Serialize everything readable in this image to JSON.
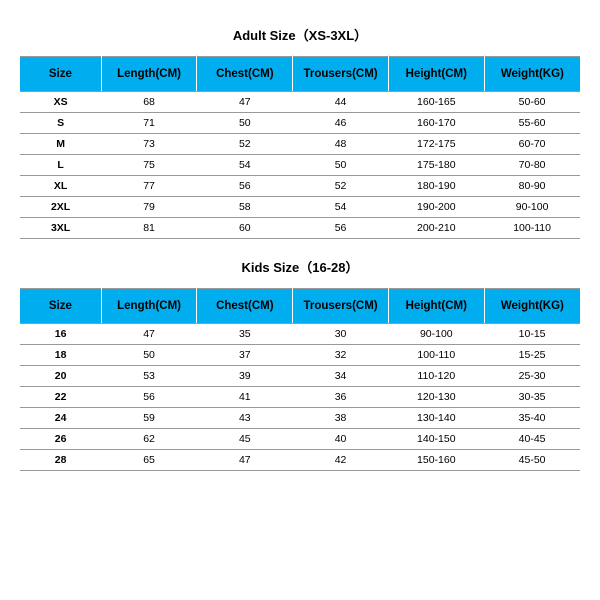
{
  "adult": {
    "title": "Adult Size（XS-3XL）",
    "headers": [
      "Size",
      "Length(CM)",
      "Chest(CM)",
      "Trousers(CM)",
      "Height(CM)",
      "Weight(KG)"
    ],
    "rows": [
      {
        "size": "XS",
        "length": "68",
        "chest": "47",
        "trousers": "44",
        "height": "160-165",
        "weight": "50-60"
      },
      {
        "size": "S",
        "length": "71",
        "chest": "50",
        "trousers": "46",
        "height": "160-170",
        "weight": "55-60"
      },
      {
        "size": "M",
        "length": "73",
        "chest": "52",
        "trousers": "48",
        "height": "172-175",
        "weight": "60-70"
      },
      {
        "size": "L",
        "length": "75",
        "chest": "54",
        "trousers": "50",
        "height": "175-180",
        "weight": "70-80"
      },
      {
        "size": "XL",
        "length": "77",
        "chest": "56",
        "trousers": "52",
        "height": "180-190",
        "weight": "80-90"
      },
      {
        "size": "2XL",
        "length": "79",
        "chest": "58",
        "trousers": "54",
        "height": "190-200",
        "weight": "90-100"
      },
      {
        "size": "3XL",
        "length": "81",
        "chest": "60",
        "trousers": "56",
        "height": "200-210",
        "weight": "100-110"
      }
    ]
  },
  "kids": {
    "title": "Kids Size（16-28）",
    "headers": [
      "Size",
      "Length(CM)",
      "Chest(CM)",
      "Trousers(CM)",
      "Height(CM)",
      "Weight(KG)"
    ],
    "rows": [
      {
        "size": "16",
        "length": "47",
        "chest": "35",
        "trousers": "30",
        "height": "90-100",
        "weight": "10-15"
      },
      {
        "size": "18",
        "length": "50",
        "chest": "37",
        "trousers": "32",
        "height": "100-110",
        "weight": "15-25"
      },
      {
        "size": "20",
        "length": "53",
        "chest": "39",
        "trousers": "34",
        "height": "110-120",
        "weight": "25-30"
      },
      {
        "size": "22",
        "length": "56",
        "chest": "41",
        "trousers": "36",
        "height": "120-130",
        "weight": "30-35"
      },
      {
        "size": "24",
        "length": "59",
        "chest": "43",
        "trousers": "38",
        "height": "130-140",
        "weight": "35-40"
      },
      {
        "size": "26",
        "length": "62",
        "chest": "45",
        "trousers": "40",
        "height": "140-150",
        "weight": "40-45"
      },
      {
        "size": "28",
        "length": "65",
        "chest": "47",
        "trousers": "42",
        "height": "150-160",
        "weight": "45-50"
      }
    ]
  },
  "chart_data": [
    {
      "type": "table",
      "title": "Adult Size (XS-3XL)",
      "columns": [
        "Size",
        "Length(CM)",
        "Chest(CM)",
        "Trousers(CM)",
        "Height(CM)",
        "Weight(KG)"
      ],
      "rows": [
        [
          "XS",
          68,
          47,
          44,
          "160-165",
          "50-60"
        ],
        [
          "S",
          71,
          50,
          46,
          "160-170",
          "55-60"
        ],
        [
          "M",
          73,
          52,
          48,
          "172-175",
          "60-70"
        ],
        [
          "L",
          75,
          54,
          50,
          "175-180",
          "70-80"
        ],
        [
          "XL",
          77,
          56,
          52,
          "180-190",
          "80-90"
        ],
        [
          "2XL",
          79,
          58,
          54,
          "190-200",
          "90-100"
        ],
        [
          "3XL",
          81,
          60,
          56,
          "200-210",
          "100-110"
        ]
      ]
    },
    {
      "type": "table",
      "title": "Kids Size (16-28)",
      "columns": [
        "Size",
        "Length(CM)",
        "Chest(CM)",
        "Trousers(CM)",
        "Height(CM)",
        "Weight(KG)"
      ],
      "rows": [
        [
          "16",
          47,
          35,
          30,
          "90-100",
          "10-15"
        ],
        [
          "18",
          50,
          37,
          32,
          "100-110",
          "15-25"
        ],
        [
          "20",
          53,
          39,
          34,
          "110-120",
          "25-30"
        ],
        [
          "22",
          56,
          41,
          36,
          "120-130",
          "30-35"
        ],
        [
          "24",
          59,
          43,
          38,
          "130-140",
          "35-40"
        ],
        [
          "26",
          62,
          45,
          40,
          "140-150",
          "40-45"
        ],
        [
          "28",
          65,
          47,
          42,
          "150-160",
          "45-50"
        ]
      ]
    }
  ]
}
